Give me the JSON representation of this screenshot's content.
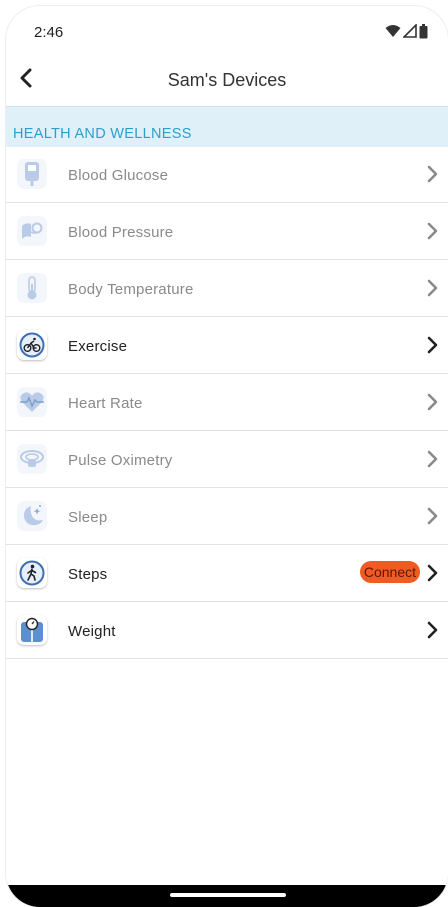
{
  "status_bar": {
    "time": "2:46"
  },
  "header": {
    "title": "Sam's Devices"
  },
  "section": {
    "title": "HEALTH AND WELLNESS"
  },
  "devices": [
    {
      "label": "Blood Glucose",
      "icon": "blood-glucose-meter-icon",
      "enabled": false
    },
    {
      "label": "Blood Pressure",
      "icon": "blood-pressure-cuff-icon",
      "enabled": false
    },
    {
      "label": "Body Temperature",
      "icon": "thermometer-icon",
      "enabled": false
    },
    {
      "label": "Exercise",
      "icon": "bicycle-icon",
      "enabled": true
    },
    {
      "label": "Heart Rate",
      "icon": "heart-rate-icon",
      "enabled": false
    },
    {
      "label": "Pulse Oximetry",
      "icon": "pulse-oximeter-icon",
      "enabled": false
    },
    {
      "label": "Sleep",
      "icon": "moon-stars-icon",
      "enabled": false
    },
    {
      "label": "Steps",
      "icon": "walking-person-icon",
      "enabled": true,
      "badge": "Connect"
    },
    {
      "label": "Weight",
      "icon": "scale-icon",
      "enabled": true
    }
  ],
  "colors": {
    "accent": "#2f9ecb",
    "section_bg": "#dff0f8",
    "badge": "#f15a22",
    "icon_blue": "#4a7fc1"
  }
}
